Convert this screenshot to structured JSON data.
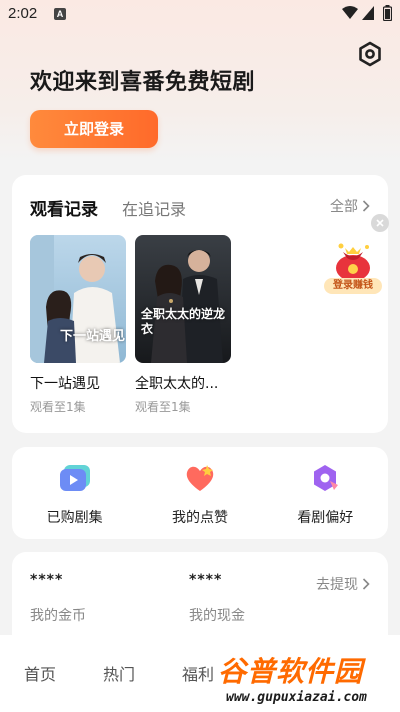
{
  "status_bar": {
    "time": "2:02",
    "notification_badge": "A"
  },
  "header": {
    "welcome_title": "欢迎来到喜番免费短剧",
    "login_button": "立即登录"
  },
  "history": {
    "tabs": [
      {
        "label": "观看记录",
        "active": true
      },
      {
        "label": "在追记录",
        "active": false
      }
    ],
    "see_all": "全部",
    "items": [
      {
        "name": "下一站遇见",
        "progress": "观看至1集",
        "poster_text": "下一站遇见"
      },
      {
        "name": "全职太太的...",
        "progress": "观看至1集",
        "poster_text": "全职太太的逆龙衣"
      }
    ]
  },
  "promo": {
    "label": "登录赚钱"
  },
  "features": [
    {
      "label": "已购剧集",
      "icon": "purchased-episodes-icon"
    },
    {
      "label": "我的点赞",
      "icon": "heart-icon"
    },
    {
      "label": "看剧偏好",
      "icon": "preference-icon"
    }
  ],
  "wallet": {
    "coins_value": "****",
    "coins_label": "我的金币",
    "cash_value": "****",
    "cash_label": "我的现金",
    "withdraw": "去提现"
  },
  "bottom_nav": [
    {
      "label": "首页"
    },
    {
      "label": "热门"
    },
    {
      "label": "福利"
    }
  ],
  "watermark": {
    "main": "谷普软件园",
    "sub": "www.gupuxiazai.com"
  },
  "colors": {
    "accent": "#ff7a30",
    "brand_orange": "#ff6a00"
  }
}
